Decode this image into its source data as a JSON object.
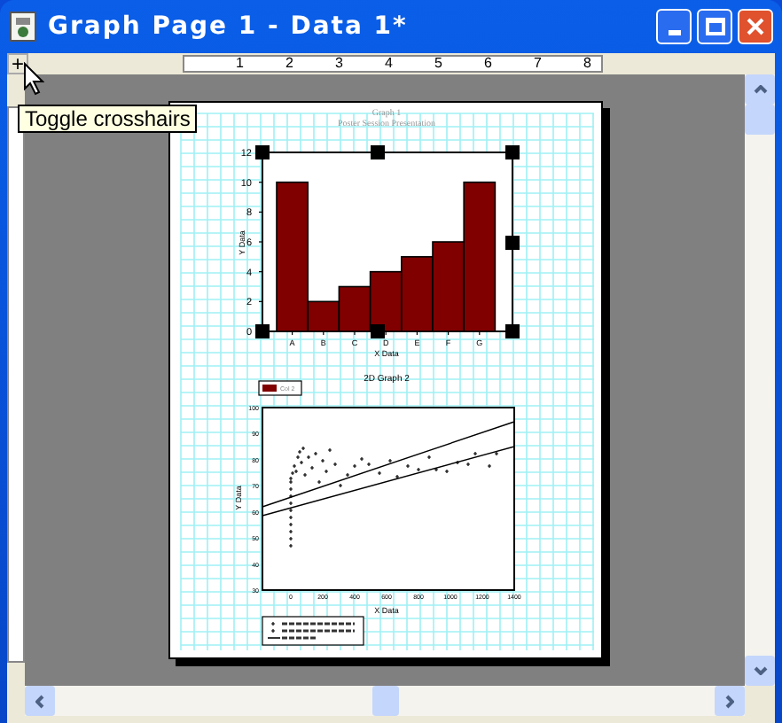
{
  "window": {
    "title": "Graph Page 1 - Data 1*"
  },
  "crosshair_button": {
    "label": "+"
  },
  "tooltip": {
    "text": "Toggle crosshairs"
  },
  "ruler": {
    "labels": [
      "1",
      "2",
      "3",
      "4",
      "5",
      "6",
      "7",
      "8"
    ]
  },
  "page": {
    "title": "Graph 1",
    "subtitle": "Poster Session Presentation",
    "bar_graph": {
      "chart_data": {
        "type": "bar",
        "categories": [
          "A",
          "B",
          "C",
          "D",
          "E",
          "F",
          "G"
        ],
        "xlabel": "X Data",
        "ylabel": "Y Data",
        "values": [
          10,
          2,
          3,
          4,
          5,
          6,
          10
        ],
        "ylim": [
          0,
          12
        ],
        "yticks": [
          {
            "value": 0,
            "label": "0"
          },
          {
            "value": 2,
            "label": "2"
          },
          {
            "value": 4,
            "label": "4"
          },
          {
            "value": 6,
            "label": "6"
          },
          {
            "value": 8,
            "label": "8"
          },
          {
            "value": 10,
            "label": "10"
          },
          {
            "value": 12,
            "label": "12"
          }
        ]
      },
      "caption": "2D Graph 2"
    },
    "scatter_graph": {
      "legend_label": "Col 2",
      "xlabel": "X Data",
      "ylabel": "Y Data",
      "yticks": [
        "100",
        "90",
        "80",
        "70",
        "60",
        "50",
        "40",
        "30"
      ],
      "xticks": [
        "0",
        "200",
        "400",
        "600",
        "800",
        "1000",
        "1200",
        "1400"
      ]
    }
  }
}
